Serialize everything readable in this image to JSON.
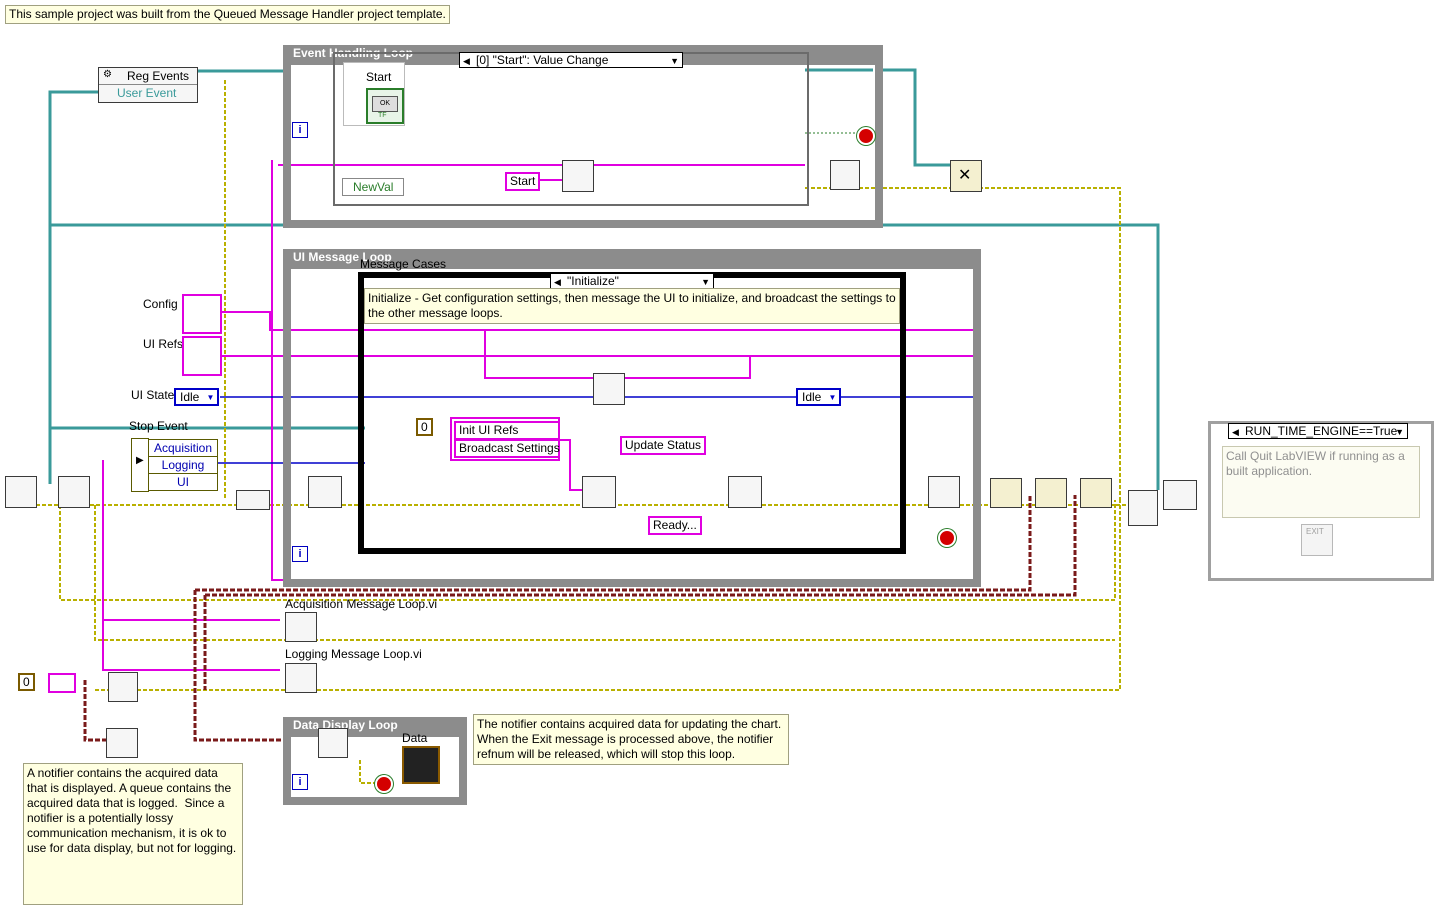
{
  "header_note": "This sample project was built from the Queued Message Handler project template.",
  "event_loop": {
    "title": "Event Handling Loop",
    "case_selector": "[0] \"Start\": Value Change",
    "start_label": "Start",
    "ok_button": "OK",
    "tf_label": "TF",
    "newval_label": "NewVal",
    "start_const": "Start",
    "iteration": "i"
  },
  "reg_events": {
    "label": "Reg Events",
    "user_event": "User Event"
  },
  "ui_loop": {
    "title": "UI Message Loop",
    "message_cases_label": "Message Cases",
    "case_selector": "\"Initialize\"",
    "description": "Initialize - Get configuration settings, then message the UI to initialize, and broadcast the settings to the other message loops.",
    "idle_const": "Idle",
    "num_const": "0",
    "init_ui_refs": "Init UI Refs",
    "broadcast_settings": "Broadcast Settings",
    "update_status": "Update Status",
    "ready": "Ready...",
    "iteration": "i"
  },
  "left_controls": {
    "config": "Config",
    "ui_refs": "UI Refs",
    "ui_state": "UI State",
    "ui_state_value": "Idle",
    "stop_event": "Stop Event",
    "cluster_items": [
      "Acquisition",
      "Logging",
      "UI"
    ]
  },
  "subvis": {
    "acquisition": "Acquisition Message Loop.vi",
    "logging": "Logging Message Loop.vi"
  },
  "data_display": {
    "title": "Data Display Loop",
    "data_label": "Data",
    "iteration": "i"
  },
  "notifier_note": "The notifier contains acquired data for updating the chart. When the Exit message is processed above, the notifier refnum will be released, which will stop this loop.",
  "bottom_note": "A notifier contains the acquired data that is displayed. A queue contains the acquired data that is logged.  Since a notifier is a potentially lossy communication mechanism, it is ok to use for data display, but not for logging.",
  "bottom_num_const": "0",
  "conditional": {
    "selector": "RUN_TIME_ENGINE==True",
    "note": "Call Quit LabVIEW if running as a built application.",
    "exit_label": "EXIT"
  },
  "colors": {
    "loop_frame": "#8c8c8c",
    "string_wire": "#e000e0",
    "enum_wire": "#0000c8",
    "refnum_wire": "#3a9a9a",
    "error_wire": "#b9b000",
    "queue_wire": "#7a1a1a"
  }
}
